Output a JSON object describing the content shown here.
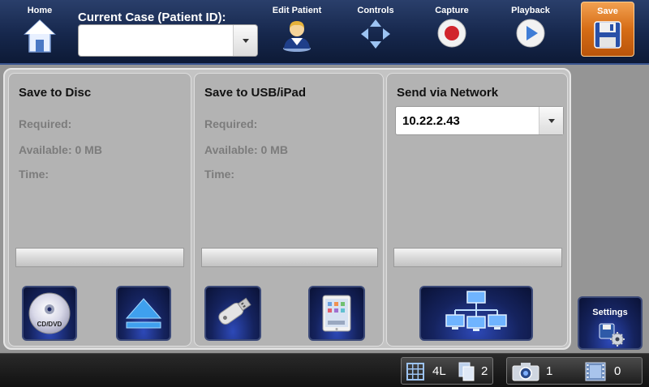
{
  "toolbar": {
    "home_label": "Home",
    "case_label": "Current Case (Patient ID):",
    "case_value": "",
    "edit_label": "Edit Patient",
    "controls_label": "Controls",
    "capture_label": "Capture",
    "playback_label": "Playback",
    "save_label": "Save",
    "active_color": "#d66d16"
  },
  "panels": {
    "disc": {
      "title": "Save to Disc",
      "required": "Required:",
      "available": "Available: 0 MB",
      "time": "Time:",
      "cd_label": "CD/DVD"
    },
    "usb": {
      "title": "Save to USB/iPad",
      "required": "Required:",
      "available": "Available: 0 MB",
      "time": "Time:"
    },
    "network": {
      "title": "Send via Network",
      "address": "10.22.2.43"
    }
  },
  "settings": {
    "label": "Settings"
  },
  "status": {
    "layout": "4L",
    "pages": "2",
    "photos": "1",
    "videos": "0"
  },
  "icons": [
    "home-icon",
    "person-icon",
    "arrows-icon",
    "record-icon",
    "play-icon",
    "floppy-icon",
    "cd-icon",
    "eject-icon",
    "usb-icon",
    "ipad-icon",
    "network-icon",
    "settings-gear-icon",
    "grid-icon",
    "pages-icon",
    "camera-icon",
    "film-icon"
  ]
}
